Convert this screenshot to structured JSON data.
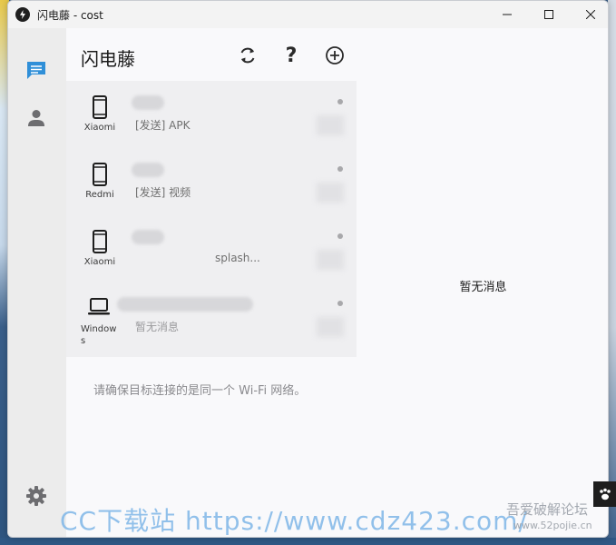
{
  "window": {
    "title": "闪电藤 - cost"
  },
  "rail": {
    "items": [
      {
        "icon": "chat-icon",
        "active": true
      },
      {
        "icon": "person-icon",
        "active": false
      },
      {
        "icon": "gear-icon",
        "active": false
      }
    ]
  },
  "panel": {
    "title": "闪电藤",
    "toolbar": {
      "refresh_label": "refresh",
      "help_label": "?",
      "add_label": "add"
    },
    "devices": [
      {
        "type": "phone",
        "name": "Xiaomi",
        "message": "[发送] APK"
      },
      {
        "type": "phone",
        "name": "Redmi",
        "message": "[发送] 视频"
      },
      {
        "type": "phone",
        "name": "Xiaomi",
        "message": "splash..."
      },
      {
        "type": "laptop",
        "name": "Window\ns",
        "message": "暂无消息"
      }
    ],
    "hint": "请确保目标连接的是同一个 Wi-Fi 网络。"
  },
  "detail": {
    "empty_message": "暂无消息"
  },
  "watermark": {
    "left": "CC下载站  https://www.cdz423.com/",
    "right": "吾爱破解论坛",
    "right_sub": "www.52pojie.cn"
  },
  "colors": {
    "accent": "#2f8fd8",
    "rail_bg": "#ececec",
    "list_bg": "#efeff1",
    "window_bg": "#f9f9fb"
  }
}
